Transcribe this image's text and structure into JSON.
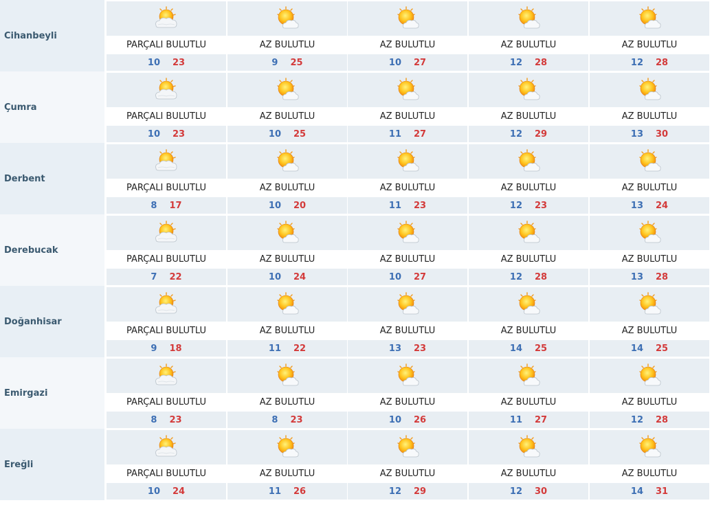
{
  "colors": {
    "min_temp": "#3d6fb4",
    "max_temp": "#d33a3a",
    "city_text": "#3b5a70",
    "cell_bg": "#e8eef3"
  },
  "cities": [
    {
      "name": "Cihanbeyli",
      "days": [
        {
          "icon": "partly-cloudy-icon",
          "condition": "PARÇALI BULUTLU",
          "min": "10",
          "max": "23"
        },
        {
          "icon": "mostly-sunny-icon",
          "condition": "AZ BULUTLU",
          "min": "9",
          "max": "25"
        },
        {
          "icon": "mostly-sunny-icon",
          "condition": "AZ BULUTLU",
          "min": "10",
          "max": "27"
        },
        {
          "icon": "mostly-sunny-icon",
          "condition": "AZ BULUTLU",
          "min": "12",
          "max": "28"
        },
        {
          "icon": "mostly-sunny-icon",
          "condition": "AZ BULUTLU",
          "min": "12",
          "max": "28"
        }
      ]
    },
    {
      "name": "Çumra",
      "days": [
        {
          "icon": "partly-cloudy-icon",
          "condition": "PARÇALI BULUTLU",
          "min": "10",
          "max": "23"
        },
        {
          "icon": "mostly-sunny-icon",
          "condition": "AZ BULUTLU",
          "min": "10",
          "max": "25"
        },
        {
          "icon": "mostly-sunny-icon",
          "condition": "AZ BULUTLU",
          "min": "11",
          "max": "27"
        },
        {
          "icon": "mostly-sunny-icon",
          "condition": "AZ BULUTLU",
          "min": "12",
          "max": "29"
        },
        {
          "icon": "mostly-sunny-icon",
          "condition": "AZ BULUTLU",
          "min": "13",
          "max": "30"
        }
      ]
    },
    {
      "name": "Derbent",
      "days": [
        {
          "icon": "partly-cloudy-icon",
          "condition": "PARÇALI BULUTLU",
          "min": "8",
          "max": "17"
        },
        {
          "icon": "mostly-sunny-icon",
          "condition": "AZ BULUTLU",
          "min": "10",
          "max": "20"
        },
        {
          "icon": "mostly-sunny-icon",
          "condition": "AZ BULUTLU",
          "min": "11",
          "max": "23"
        },
        {
          "icon": "mostly-sunny-icon",
          "condition": "AZ BULUTLU",
          "min": "12",
          "max": "23"
        },
        {
          "icon": "mostly-sunny-icon",
          "condition": "AZ BULUTLU",
          "min": "13",
          "max": "24"
        }
      ]
    },
    {
      "name": "Derebucak",
      "days": [
        {
          "icon": "partly-cloudy-icon",
          "condition": "PARÇALI BULUTLU",
          "min": "7",
          "max": "22"
        },
        {
          "icon": "mostly-sunny-icon",
          "condition": "AZ BULUTLU",
          "min": "10",
          "max": "24"
        },
        {
          "icon": "mostly-sunny-icon",
          "condition": "AZ BULUTLU",
          "min": "10",
          "max": "27"
        },
        {
          "icon": "mostly-sunny-icon",
          "condition": "AZ BULUTLU",
          "min": "12",
          "max": "28"
        },
        {
          "icon": "mostly-sunny-icon",
          "condition": "AZ BULUTLU",
          "min": "13",
          "max": "28"
        }
      ]
    },
    {
      "name": "Doğanhisar",
      "days": [
        {
          "icon": "partly-cloudy-icon",
          "condition": "PARÇALI BULUTLU",
          "min": "9",
          "max": "18"
        },
        {
          "icon": "mostly-sunny-icon",
          "condition": "AZ BULUTLU",
          "min": "11",
          "max": "22"
        },
        {
          "icon": "mostly-sunny-icon",
          "condition": "AZ BULUTLU",
          "min": "13",
          "max": "23"
        },
        {
          "icon": "mostly-sunny-icon",
          "condition": "AZ BULUTLU",
          "min": "14",
          "max": "25"
        },
        {
          "icon": "mostly-sunny-icon",
          "condition": "AZ BULUTLU",
          "min": "14",
          "max": "25"
        }
      ]
    },
    {
      "name": "Emirgazi",
      "days": [
        {
          "icon": "partly-cloudy-icon",
          "condition": "PARÇALI BULUTLU",
          "min": "8",
          "max": "23"
        },
        {
          "icon": "mostly-sunny-icon",
          "condition": "AZ BULUTLU",
          "min": "8",
          "max": "23"
        },
        {
          "icon": "mostly-sunny-icon",
          "condition": "AZ BULUTLU",
          "min": "10",
          "max": "26"
        },
        {
          "icon": "mostly-sunny-icon",
          "condition": "AZ BULUTLU",
          "min": "11",
          "max": "27"
        },
        {
          "icon": "mostly-sunny-icon",
          "condition": "AZ BULUTLU",
          "min": "12",
          "max": "28"
        }
      ]
    },
    {
      "name": "Ereğli",
      "days": [
        {
          "icon": "partly-cloudy-icon",
          "condition": "PARÇALI BULUTLU",
          "min": "10",
          "max": "24"
        },
        {
          "icon": "mostly-sunny-icon",
          "condition": "AZ BULUTLU",
          "min": "11",
          "max": "26"
        },
        {
          "icon": "mostly-sunny-icon",
          "condition": "AZ BULUTLU",
          "min": "12",
          "max": "29"
        },
        {
          "icon": "mostly-sunny-icon",
          "condition": "AZ BULUTLU",
          "min": "12",
          "max": "30"
        },
        {
          "icon": "mostly-sunny-icon",
          "condition": "AZ BULUTLU",
          "min": "14",
          "max": "31"
        }
      ]
    }
  ]
}
